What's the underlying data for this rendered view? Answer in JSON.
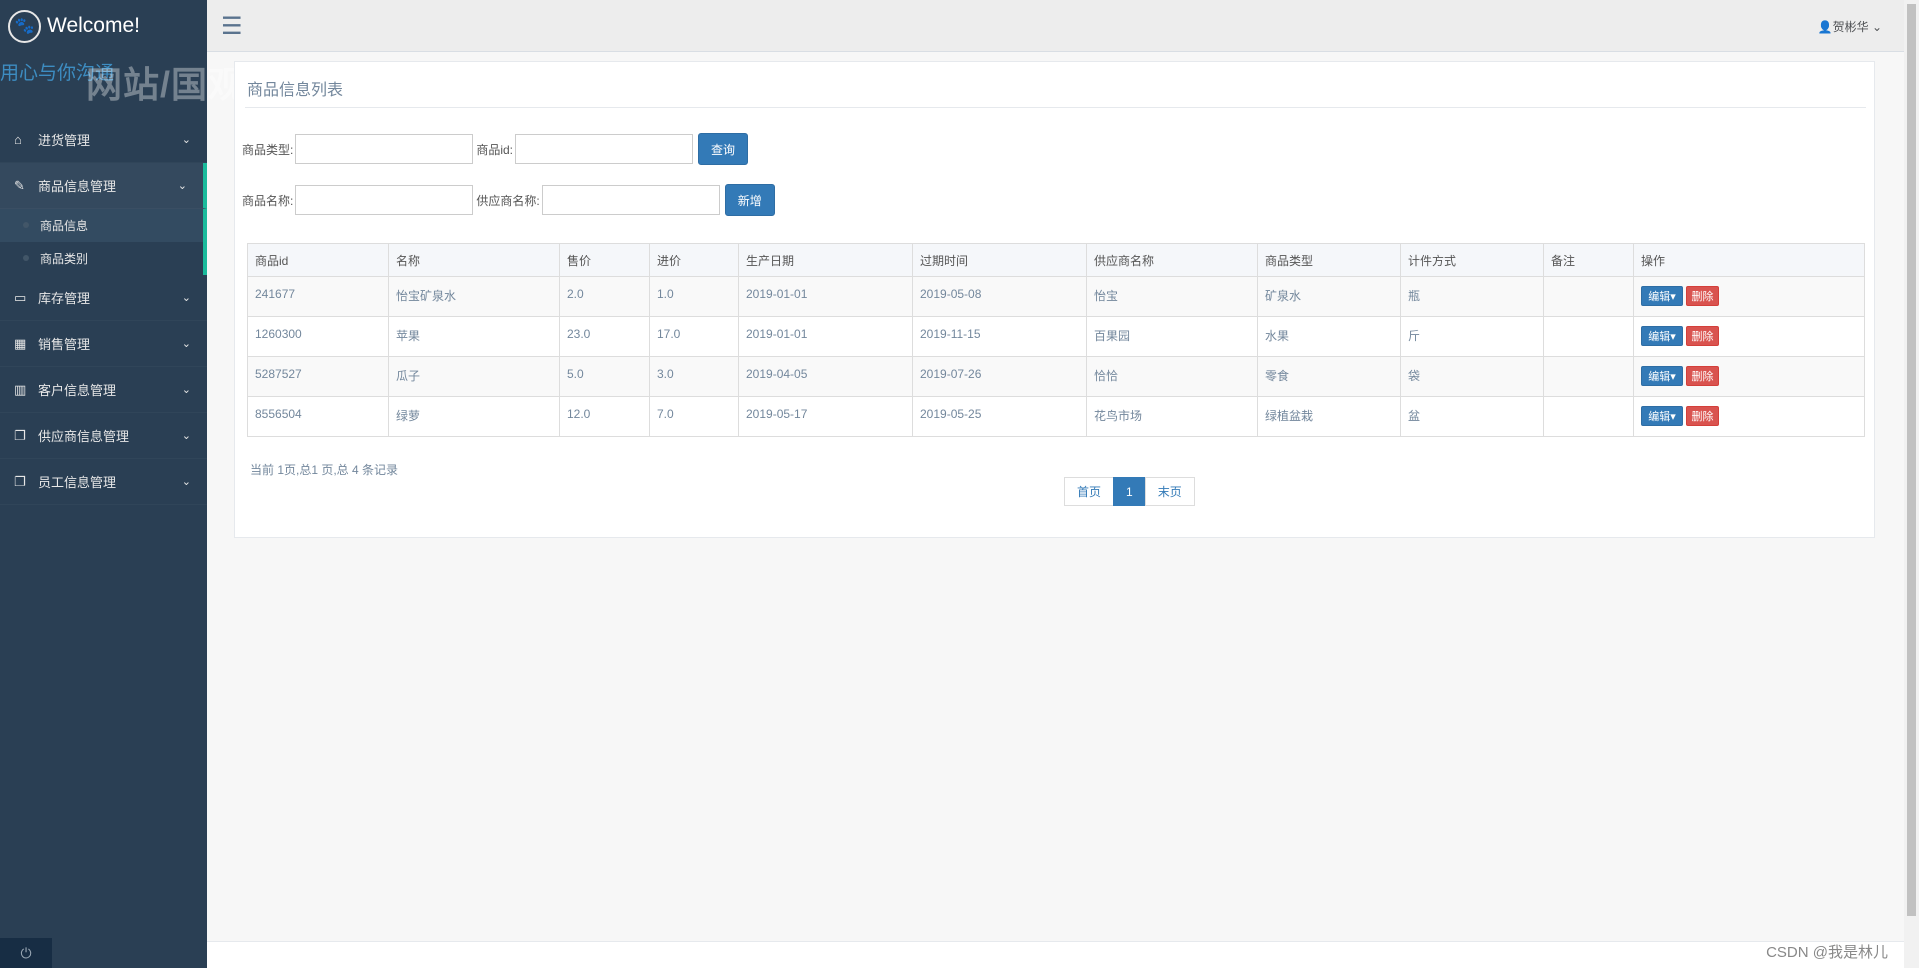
{
  "brand": {
    "title": "Welcome!",
    "subtitle": "用心与你沟通",
    "watermark": "网站/国观宗"
  },
  "sidebar": {
    "items": [
      {
        "label": "进货管理",
        "icon": "home-icon"
      },
      {
        "label": "商品信息管理",
        "icon": "edit-icon"
      },
      {
        "label": "库存管理",
        "icon": "monitor-icon"
      },
      {
        "label": "销售管理",
        "icon": "table-icon"
      },
      {
        "label": "客户信息管理",
        "icon": "bar-chart-icon"
      },
      {
        "label": "供应商信息管理",
        "icon": "copy-icon"
      },
      {
        "label": "员工信息管理",
        "icon": "copy-icon"
      }
    ],
    "submenu": [
      {
        "label": "商品信息"
      },
      {
        "label": "商品类别"
      }
    ]
  },
  "topnav": {
    "user": "贺彬华"
  },
  "panel": {
    "title": "商品信息列表"
  },
  "search": {
    "type_label": "商品类型:",
    "id_label": "商品id:",
    "query_button": "查询",
    "name_label": "商品名称:",
    "supplier_label": "供应商名称:",
    "add_button": "新增"
  },
  "table": {
    "headers": [
      "商品id",
      "名称",
      "售价",
      "进价",
      "生产日期",
      "过期时间",
      "供应商名称",
      "商品类型",
      "计件方式",
      "备注",
      "操作"
    ],
    "rows": [
      [
        "241677",
        "怡宝矿泉水",
        "2.0",
        "1.0",
        "2019-01-01",
        "2019-05-08",
        "怡宝",
        "矿泉水",
        "瓶",
        ""
      ],
      [
        "1260300",
        "苹果",
        "23.0",
        "17.0",
        "2019-01-01",
        "2019-11-15",
        "百果园",
        "水果",
        "斤",
        ""
      ],
      [
        "5287527",
        "瓜子",
        "5.0",
        "3.0",
        "2019-04-05",
        "2019-07-26",
        "恰恰",
        "零食",
        "袋",
        ""
      ],
      [
        "8556504",
        "绿萝",
        "12.0",
        "7.0",
        "2019-05-17",
        "2019-05-25",
        "花鸟市场",
        "绿植盆栽",
        "盆",
        ""
      ]
    ],
    "edit_label": "编辑",
    "delete_label": "删除"
  },
  "pagination": {
    "info": "当前 1页,总1 页,总 4 条记录",
    "first": "首页",
    "current": "1",
    "last": "末页"
  },
  "watermark_footer": "CSDN @我是林儿"
}
